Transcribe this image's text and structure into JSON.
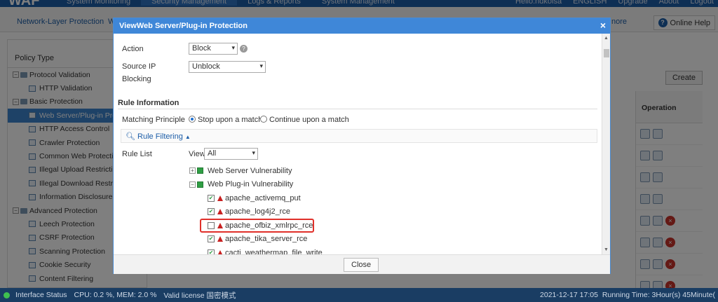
{
  "topbar": {
    "logo": "WAF",
    "nav": [
      "System Monitoring",
      "Security Management",
      "Logs & Reports",
      "System Management"
    ],
    "right": [
      "Hello:ndkolsa",
      "ENGLISH",
      "Upgrade",
      "About",
      "Logout"
    ]
  },
  "subnav": {
    "items": [
      "Network-Layer Protection",
      "W",
      "nore"
    ],
    "help": "Online Help"
  },
  "left": {
    "title": "Policy Type",
    "tree": [
      {
        "label": "Protocol Validation",
        "level": 0
      },
      {
        "label": "HTTP Validation",
        "level": 1
      },
      {
        "label": "Basic Protection",
        "level": 0
      },
      {
        "label": "Web Server/Plug-in Pro",
        "level": 1,
        "selected": true
      },
      {
        "label": "HTTP Access Control",
        "level": 1
      },
      {
        "label": "Crawler Protection",
        "level": 1
      },
      {
        "label": "Common Web Protectio",
        "level": 1
      },
      {
        "label": "Illegal Upload Restricti...",
        "level": 1
      },
      {
        "label": "Illegal Download Restric",
        "level": 1
      },
      {
        "label": "Information Disclosure F",
        "level": 1
      },
      {
        "label": "Advanced Protection",
        "level": 0
      },
      {
        "label": "Leech Protection",
        "level": 1
      },
      {
        "label": "CSRF Protection",
        "level": 1
      },
      {
        "label": "Scanning Protection",
        "level": 1
      },
      {
        "label": "Cookie Security",
        "level": 1
      },
      {
        "label": "Content Filtering",
        "level": 1
      }
    ]
  },
  "right": {
    "create_label": "Create",
    "operation_header": "Operation"
  },
  "status": {
    "iface": "Interface Status",
    "cpu": "CPU: 0.2 %, MEM: 2.0 %",
    "license": "Valid license 国密模式",
    "time": "2021-12-17 17:05",
    "running": "Running Time: 3Hour(s) 45Minute("
  },
  "modal": {
    "title": "ViewWeb Server/Plug-in Protection",
    "close_x": "×",
    "action_label": "Action",
    "action_value": "Block",
    "srcip_label": "Source IP",
    "srcip_label2": "Blocking",
    "srcip_value": "Unblock",
    "section": "Rule Information",
    "matching_label": "Matching Principle",
    "radio_stop": "Stop upon a match",
    "radio_continue": "Continue upon a match",
    "filter_label": "Rule Filtering",
    "rulelist_label": "Rule List",
    "view_label": "View",
    "view_value": "All",
    "groups": [
      {
        "label": "Web Server Vulnerability",
        "expander": "+"
      },
      {
        "label": "Web Plug-in Vulnerability",
        "expander": "−"
      }
    ],
    "rules": [
      {
        "label": "apache_activemq_put",
        "checked": true
      },
      {
        "label": "apache_log4j2_rce",
        "checked": true
      },
      {
        "label": "apache_ofbiz_xmlrpc_rce",
        "checked": false
      },
      {
        "label": "apache_tika_server_rce",
        "checked": true
      },
      {
        "label": "cacti_weathermap_file_write",
        "checked": true
      }
    ],
    "close_button": "Close"
  },
  "colors": {
    "brand": "#1d5ea8",
    "modal_header": "#3f87d8",
    "highlight": "#e0302a",
    "status_bar": "#1a3d63"
  }
}
